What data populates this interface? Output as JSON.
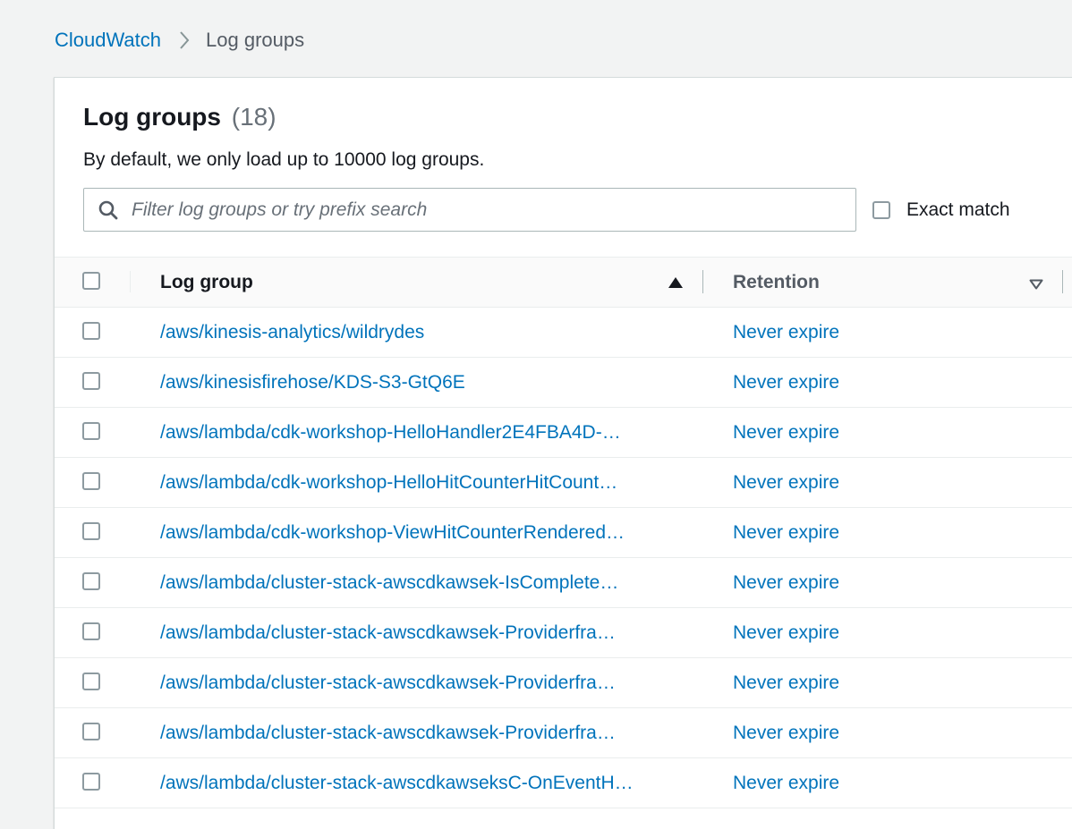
{
  "breadcrumb": {
    "root": "CloudWatch",
    "current": "Log groups"
  },
  "panel": {
    "title": "Log groups",
    "count": "(18)",
    "description": "By default, we only load up to 10000 log groups."
  },
  "search": {
    "placeholder": "Filter log groups or try prefix search",
    "value": ""
  },
  "exact_match": {
    "label": "Exact match",
    "checked": false
  },
  "table": {
    "columns": [
      {
        "label": "Log group",
        "sort": "ascending"
      },
      {
        "label": "Retention",
        "sort": "none"
      }
    ],
    "rows": [
      {
        "log_group": "/aws/kinesis-analytics/wildrydes",
        "retention": "Never expire"
      },
      {
        "log_group": "/aws/kinesisfirehose/KDS-S3-GtQ6E",
        "retention": "Never expire"
      },
      {
        "log_group": "/aws/lambda/cdk-workshop-HelloHandler2E4FBA4D-…",
        "retention": "Never expire"
      },
      {
        "log_group": "/aws/lambda/cdk-workshop-HelloHitCounterHitCount…",
        "retention": "Never expire"
      },
      {
        "log_group": "/aws/lambda/cdk-workshop-ViewHitCounterRendered…",
        "retention": "Never expire"
      },
      {
        "log_group": "/aws/lambda/cluster-stack-awscdkawsek-IsComplete…",
        "retention": "Never expire"
      },
      {
        "log_group": "/aws/lambda/cluster-stack-awscdkawsek-Providerfra…",
        "retention": "Never expire"
      },
      {
        "log_group": "/aws/lambda/cluster-stack-awscdkawsek-Providerfra…",
        "retention": "Never expire"
      },
      {
        "log_group": "/aws/lambda/cluster-stack-awscdkawsek-Providerfra…",
        "retention": "Never expire"
      },
      {
        "log_group": "/aws/lambda/cluster-stack-awscdkawseksC-OnEventH…",
        "retention": "Never expire"
      }
    ]
  },
  "icons": {
    "breadcrumb_separator": "chevron-right-icon",
    "search": "search-icon",
    "sort_ascending": "caret-up-icon",
    "sort_none": "caret-down-outline-icon"
  },
  "colors": {
    "link": "#0073bb",
    "page_background": "#f2f3f3",
    "text": "#16191f"
  }
}
